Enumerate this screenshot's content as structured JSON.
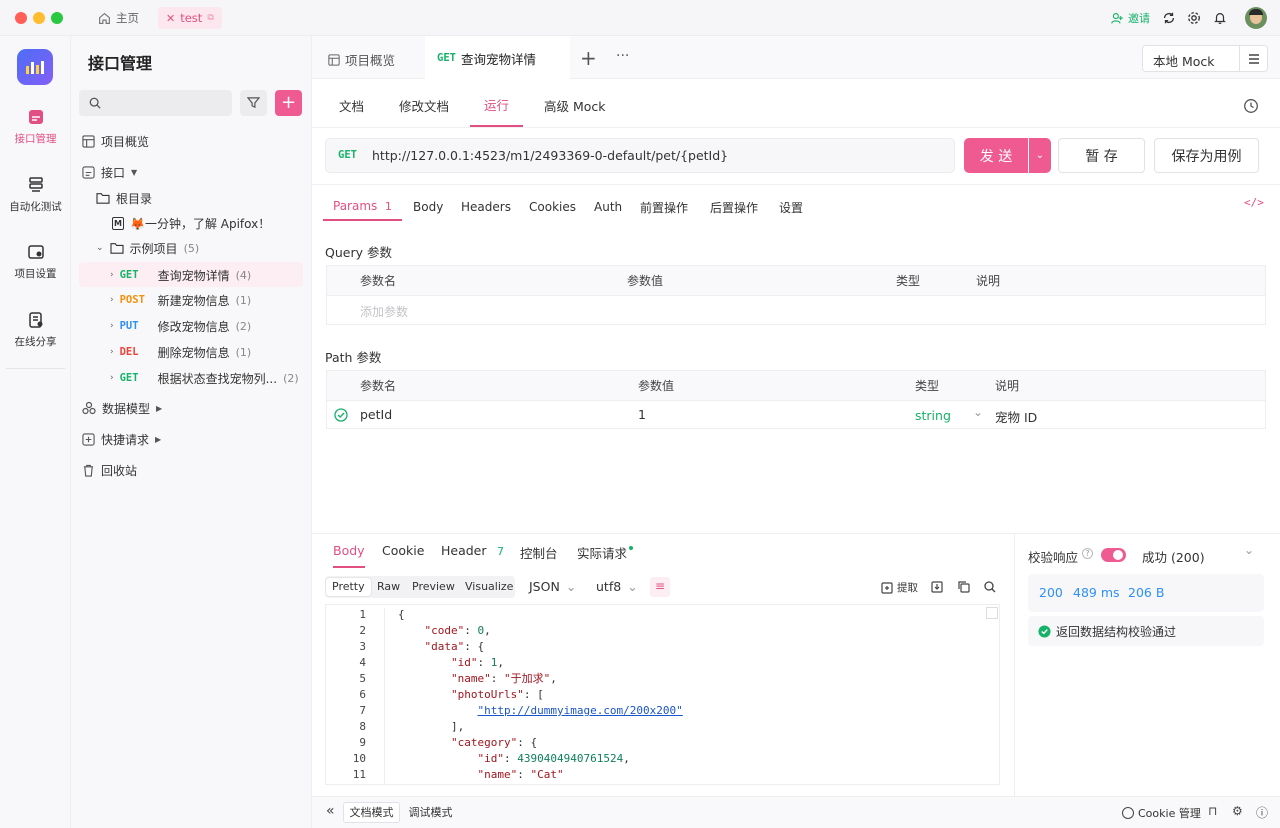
{
  "titlebar": {
    "home_tab": "主页",
    "active_tab": "test",
    "invite": "邀请"
  },
  "rail": {
    "items": [
      "接口管理",
      "自动化测试",
      "项目设置",
      "在线分享"
    ]
  },
  "tree": {
    "title": "接口管理",
    "overview": "项目概览",
    "interfaces": "接口",
    "root": "根目录",
    "intro": "🦊一分钟，了解 Apifox！",
    "sample_folder": "示例项目",
    "sample_count": "(5)",
    "endpoints": [
      {
        "method": "GET",
        "color": "#17b26a",
        "name": "查询宠物详情",
        "count": "(4)"
      },
      {
        "method": "POST",
        "color": "#f79009",
        "name": "新建宠物信息",
        "count": "(1)"
      },
      {
        "method": "PUT",
        "color": "#2e90fa",
        "name": "修改宠物信息",
        "count": "(2)"
      },
      {
        "method": "DEL",
        "color": "#f04438",
        "name": "删除宠物信息",
        "count": "(1)"
      },
      {
        "method": "GET",
        "color": "#17b26a",
        "name": "根据状态查找宠物列...",
        "count": "(2)"
      }
    ],
    "data_model": "数据模型",
    "quick_request": "快捷请求",
    "recycle": "回收站"
  },
  "tabs": {
    "overview": "项目概览",
    "active_method": "GET",
    "active_name": "查询宠物详情",
    "env": "本地 Mock"
  },
  "subtabs": [
    "文档",
    "修改文档",
    "运行",
    "高级 Mock"
  ],
  "request": {
    "method": "GET",
    "url": "http://127.0.0.1:4523/m1/2493369-0-default/pet/{petId}",
    "send": "发 送",
    "save": "暂 存",
    "save_case": "保存为用例"
  },
  "param_tabs": [
    "Params",
    "Body",
    "Headers",
    "Cookies",
    "Auth",
    "前置操作",
    "后置操作",
    "设置"
  ],
  "params_count": "1",
  "query": {
    "title": "Query 参数",
    "headers": [
      "参数名",
      "参数值",
      "类型",
      "说明"
    ],
    "placeholder": "添加参数"
  },
  "path": {
    "title": "Path 参数",
    "headers": [
      "参数名",
      "参数值",
      "类型",
      "说明"
    ],
    "row": {
      "name": "petId",
      "value": "1",
      "type": "string",
      "desc": "宠物 ID"
    }
  },
  "response": {
    "tabs": [
      "Body",
      "Cookie",
      "Header",
      "控制台",
      "实际请求"
    ],
    "header_count": "7",
    "views": [
      "Pretty",
      "Raw",
      "Preview",
      "Visualize"
    ],
    "format": "JSON",
    "encoding": "utf8",
    "extract": "提取",
    "code_lines": [
      "{",
      "    \"code\": 0,",
      "    \"data\": {",
      "        \"id\": 1,",
      "        \"name\": \"于加求\",",
      "        \"photoUrls\": [",
      "            \"http://dummyimage.com/200x200\"",
      "        ],",
      "        \"category\": {",
      "            \"id\": 4390404940761524,",
      "            \"name\": \"Cat\""
    ],
    "validate_label": "校验响应",
    "validate_status": "成功 (200)",
    "status": "200",
    "time": "489 ms",
    "size": "206 B",
    "validate_pass": "返回数据结构校验通过"
  },
  "footer": {
    "doc_mode": "文档模式",
    "debug_mode": "调试模式",
    "cookie": "Cookie 管理"
  }
}
